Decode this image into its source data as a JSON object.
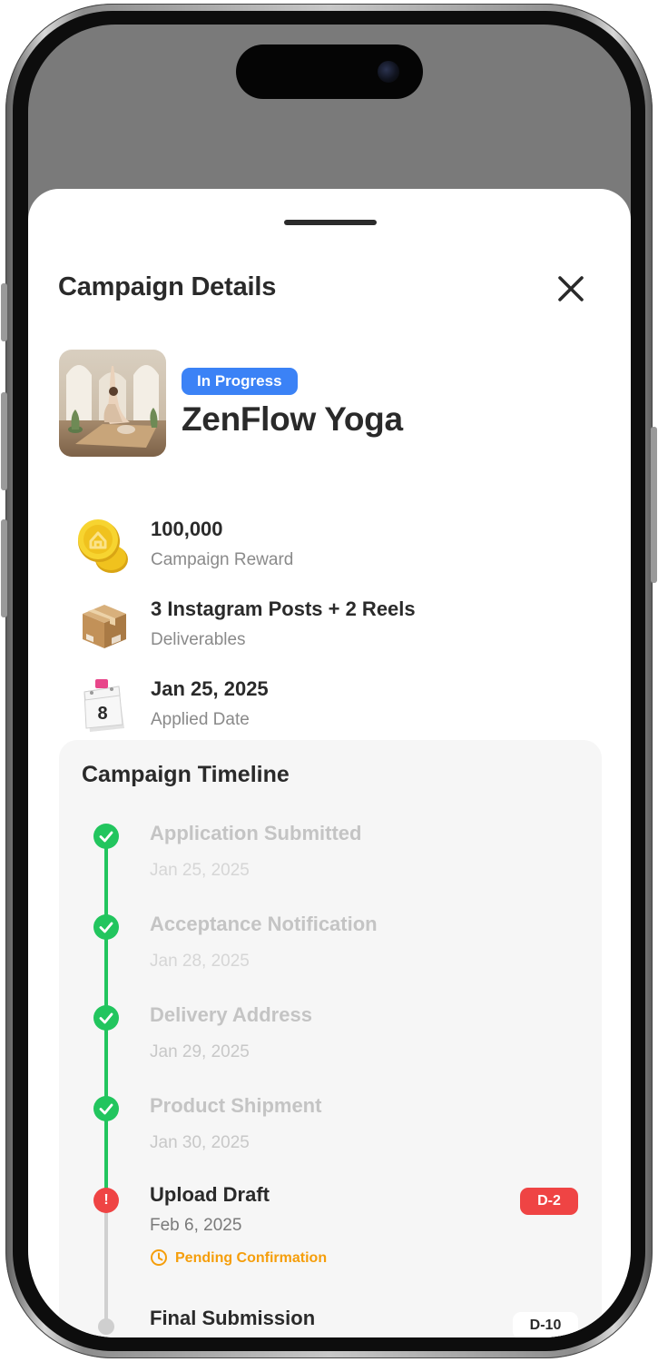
{
  "sheet": {
    "title": "Campaign Details"
  },
  "campaign": {
    "status": "In Progress",
    "name": "ZenFlow Yoga",
    "thumbnail_icon": "yoga-photo",
    "status_color": "#3b82f6"
  },
  "info": [
    {
      "icon": "gold-coin-icon",
      "value": "100,000",
      "label": "Campaign Reward"
    },
    {
      "icon": "package-box-icon",
      "value": "3 Instagram Posts + 2 Reels",
      "label": "Deliverables"
    },
    {
      "icon": "calendar-icon",
      "value": "Jan 25, 2025",
      "label": "Applied Date"
    }
  ],
  "calendar_day": "8",
  "timeline": {
    "title": "Campaign Timeline",
    "steps": [
      {
        "title": "Application Submitted",
        "date": "Jan 25, 2025",
        "state": "done"
      },
      {
        "title": "Acceptance Notification",
        "date": "Jan 28, 2025",
        "state": "done"
      },
      {
        "title": "Delivery Address",
        "date": "Jan 29, 2025",
        "state": "done"
      },
      {
        "title": "Product Shipment",
        "date": "Jan 30, 2025",
        "state": "done"
      },
      {
        "title": "Upload Draft",
        "date": "Feb 6, 2025",
        "state": "current",
        "badge": "D-2",
        "note": "Pending Confirmation",
        "node_symbol": "!"
      },
      {
        "title": "Final Submission",
        "state": "upcoming",
        "badge": "D-10"
      }
    ]
  },
  "colors": {
    "done": "#22c55e",
    "alert": "#ef4444",
    "pending": "#f59e0b"
  }
}
